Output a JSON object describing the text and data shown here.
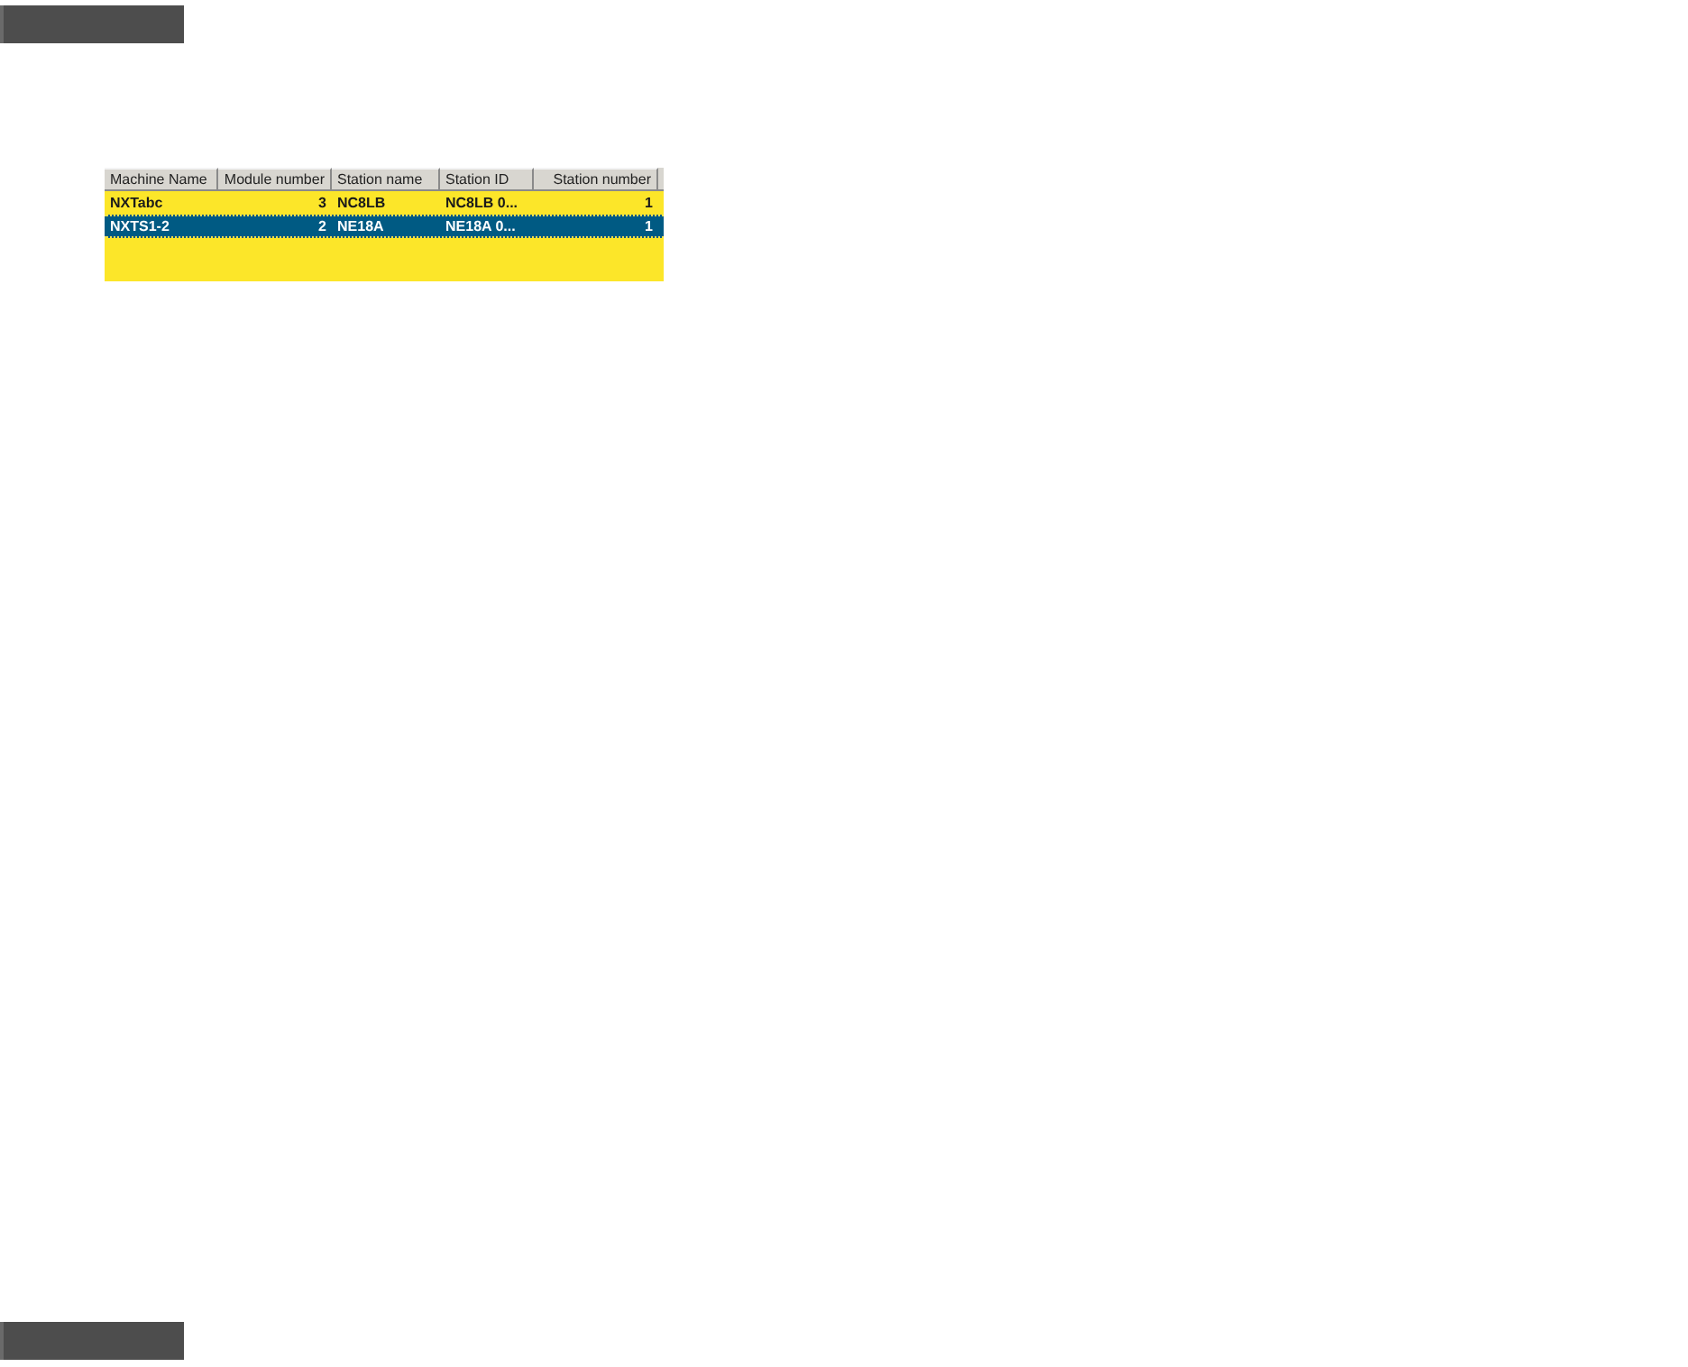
{
  "table": {
    "columns": [
      {
        "label": "Machine Name",
        "kind": "text"
      },
      {
        "label": "Module number",
        "kind": "number"
      },
      {
        "label": "Station name",
        "kind": "text"
      },
      {
        "label": "Station ID",
        "kind": "text"
      },
      {
        "label": "Station number",
        "kind": "number"
      }
    ],
    "rows": [
      {
        "cells": [
          "NXTabc",
          "3",
          "NC8LB",
          "NC8LB 0...",
          "1"
        ],
        "selected": false
      },
      {
        "cells": [
          "NXTS1-2",
          "2",
          "NE18A",
          "NE18A 0...",
          "1"
        ],
        "selected": true
      }
    ]
  }
}
